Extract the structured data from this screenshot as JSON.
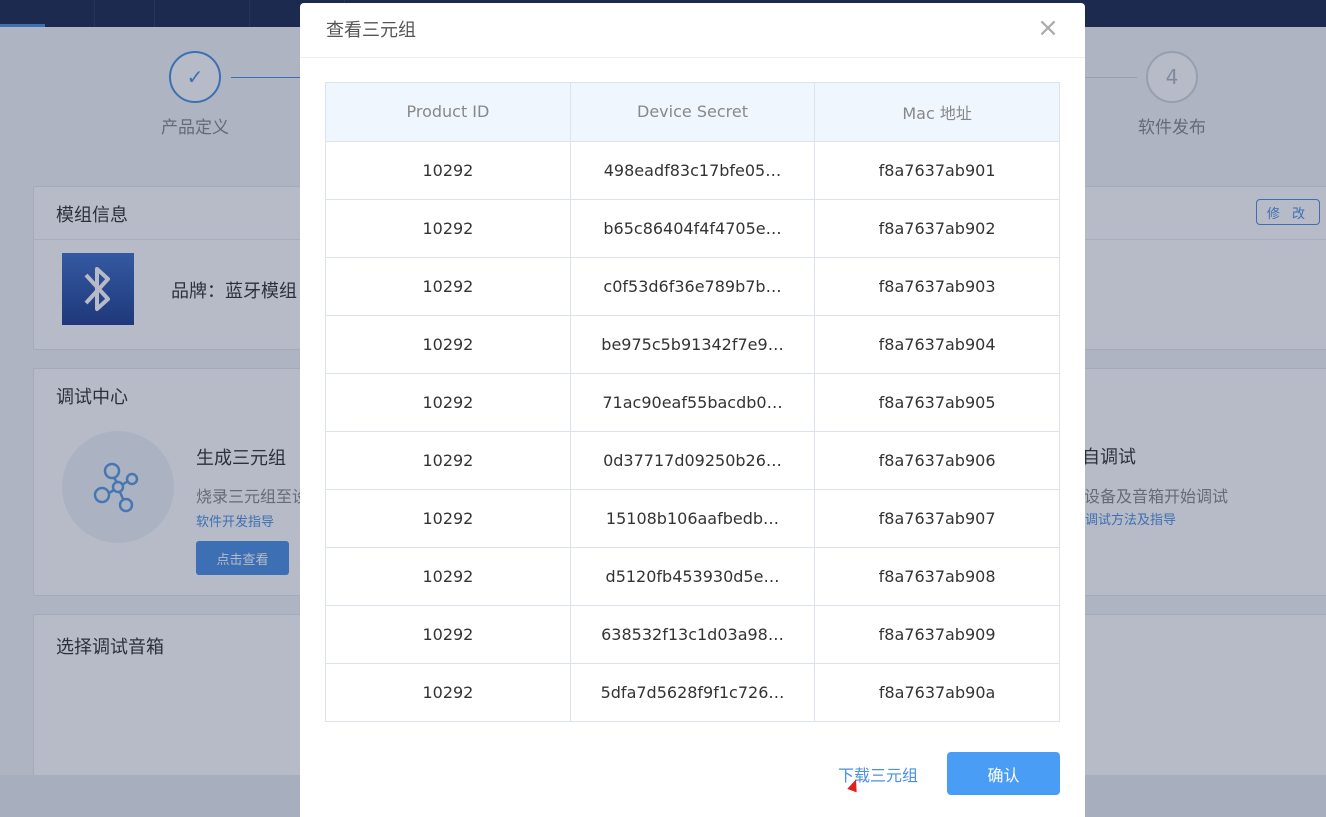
{
  "steps": [
    {
      "label": "产品定义",
      "mark": "✓"
    },
    {
      "label": "软件发布",
      "mark": "4"
    }
  ],
  "module_card": {
    "title": "模组信息",
    "edit_label": "修 改",
    "brand": "品牌：蓝牙模组"
  },
  "debug_card": {
    "title": "调试中心",
    "gen_title": "生成三元组",
    "gen_desc": "烧录三元组至设",
    "gen_link": "软件开发指导",
    "gen_button": "点击查看",
    "right_title": "自调试",
    "right_desc": "择设备及音箱开始调试",
    "right_link": "看调试方法及指导"
  },
  "speaker_card": {
    "title": "选择调试音箱"
  },
  "modal": {
    "title": "查看三元组",
    "close_glyph": "×",
    "download_label": "下载三元组",
    "confirm_label": "确认"
  },
  "table": {
    "headers": [
      "Product ID",
      "Device Secret",
      "Mac 地址"
    ],
    "rows": [
      [
        "10292",
        "498eadf83c17bfe05…",
        "f8a7637ab901"
      ],
      [
        "10292",
        "b65c86404f4f4705e…",
        "f8a7637ab902"
      ],
      [
        "10292",
        "c0f53d6f36e789b7b…",
        "f8a7637ab903"
      ],
      [
        "10292",
        "be975c5b91342f7e9…",
        "f8a7637ab904"
      ],
      [
        "10292",
        "71ac90eaf55bacdb0…",
        "f8a7637ab905"
      ],
      [
        "10292",
        "0d37717d09250b26…",
        "f8a7637ab906"
      ],
      [
        "10292",
        "15108b106aafbedb…",
        "f8a7637ab907"
      ],
      [
        "10292",
        "d5120fb453930d5e…",
        "f8a7637ab908"
      ],
      [
        "10292",
        "638532f13c1d03a98…",
        "f8a7637ab909"
      ],
      [
        "10292",
        "5dfa7d5628f9f1c726…",
        "f8a7637ab90a"
      ]
    ]
  },
  "icons": {
    "bluetooth": "bluetooth-icon",
    "molecule": "molecule-icon",
    "close": "close-icon",
    "check": "check-icon"
  },
  "colors": {
    "accent": "#4a90e2",
    "confirm": "#4a9df5",
    "header_bg": "#f0f6fd",
    "topbar": "#1b2a4e"
  }
}
